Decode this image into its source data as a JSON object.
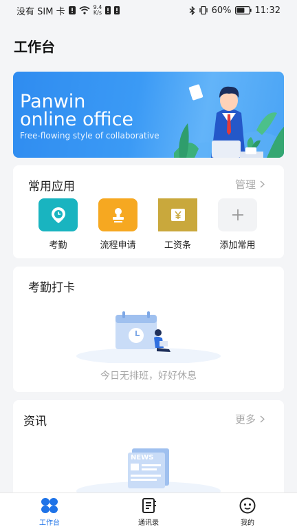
{
  "status_bar": {
    "carrier": "没有 SIM 卡",
    "net_speed_value": "9.4",
    "net_speed_unit": "K/s",
    "battery": "60%",
    "time": "11:32"
  },
  "page": {
    "title": "工作台"
  },
  "banner": {
    "title_line1": "Panwin",
    "title_line2": "online office",
    "subtitle": "Free-flowing style of collaborative"
  },
  "apps": {
    "title": "常用应用",
    "manage_label": "管理",
    "items": [
      {
        "label": "考勤",
        "icon": "location-clock-icon",
        "color": "#19b4c0"
      },
      {
        "label": "流程申请",
        "icon": "stamp-icon",
        "color": "#f6a821"
      },
      {
        "label": "工资条",
        "icon": "yen-icon",
        "color": "#c9a83c"
      },
      {
        "label": "添加常用",
        "icon": "plus-icon",
        "color": "#f2f3f5"
      }
    ]
  },
  "attendance": {
    "title": "考勤打卡",
    "empty_text": "今日无排班，好好休息"
  },
  "news": {
    "title": "资讯",
    "more_label": "更多",
    "illustration_text": "NEWS"
  },
  "tab_bar": {
    "items": [
      {
        "label": "工作台",
        "icon": "workbench-icon",
        "active": true
      },
      {
        "label": "通讯录",
        "icon": "contacts-icon",
        "active": false
      },
      {
        "label": "我的",
        "icon": "profile-icon",
        "active": false
      }
    ]
  },
  "colors": {
    "accent": "#1e73e8",
    "banner": "#3b9af5"
  }
}
